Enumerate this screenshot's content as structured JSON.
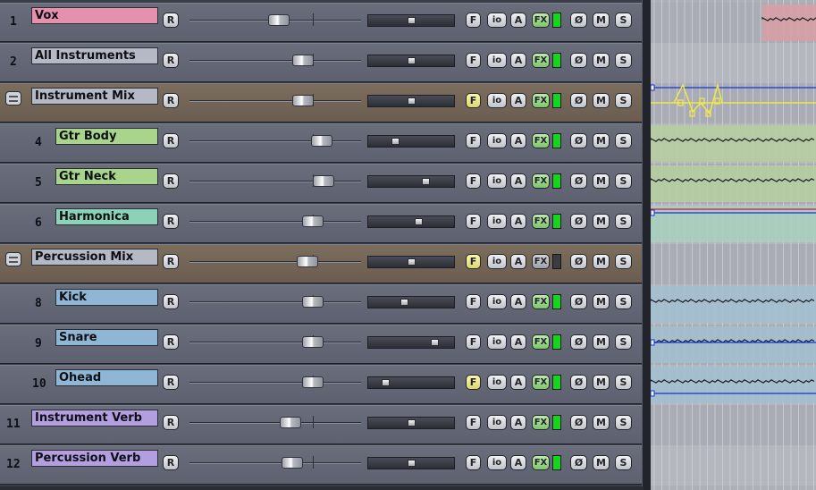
{
  "buttons": {
    "rec_arm": "R",
    "fx_browser": "F",
    "io": "io",
    "automation": "A",
    "fx": "FX",
    "phase": "Ø",
    "mute": "M",
    "solo": "S"
  },
  "colors": {
    "accent_fx_on": "#12d81b",
    "folder_bg": "#7c6d5d",
    "track_bg": "#6a6e7b"
  },
  "tracks": [
    {
      "number": "1",
      "name": "Vox",
      "color": "#e590ad",
      "indent": 0,
      "folder": false,
      "volume": 0.52,
      "pan": 0.5,
      "f_active": false,
      "fx_on": true
    },
    {
      "number": "2",
      "name": "All Instruments",
      "color": "#b5b9c5",
      "indent": 0,
      "folder": false,
      "volume": 0.66,
      "pan": 0.5,
      "f_active": false,
      "fx_on": true
    },
    {
      "number": "",
      "name": "Instrument Mix",
      "color": "#b5b9c5",
      "indent": 0,
      "folder": true,
      "volume": 0.66,
      "pan": 0.5,
      "f_active": true,
      "fx_on": true
    },
    {
      "number": "4",
      "name": "Gtr Body",
      "color": "#a8d48c",
      "indent": 1,
      "folder": false,
      "volume": 0.77,
      "pan": 0.3,
      "f_active": false,
      "fx_on": true
    },
    {
      "number": "5",
      "name": "Gtr Neck",
      "color": "#a8d48c",
      "indent": 1,
      "folder": false,
      "volume": 0.78,
      "pan": 0.68,
      "f_active": false,
      "fx_on": true
    },
    {
      "number": "6",
      "name": "Harmonica",
      "color": "#8bd3b6",
      "indent": 1,
      "folder": false,
      "volume": 0.72,
      "pan": 0.59,
      "f_active": false,
      "fx_on": true
    },
    {
      "number": "",
      "name": "Percussion Mix",
      "color": "#b5b9c5",
      "indent": 0,
      "folder": true,
      "volume": 0.69,
      "pan": 0.5,
      "f_active": true,
      "fx_on": false
    },
    {
      "number": "8",
      "name": "Kick",
      "color": "#8fb6d4",
      "indent": 1,
      "folder": false,
      "volume": 0.72,
      "pan": 0.41,
      "f_active": false,
      "fx_on": true
    },
    {
      "number": "9",
      "name": "Snare",
      "color": "#8fb6d4",
      "indent": 1,
      "folder": false,
      "volume": 0.72,
      "pan": 0.8,
      "f_active": false,
      "fx_on": true
    },
    {
      "number": "10",
      "name": "Ohead",
      "color": "#8fb6d4",
      "indent": 1,
      "folder": false,
      "volume": 0.72,
      "pan": 0.17,
      "f_active": true,
      "fx_on": true
    },
    {
      "number": "11",
      "name": "Instrument Verb",
      "color": "#b39fe0",
      "indent": 0,
      "folder": false,
      "volume": 0.59,
      "pan": 0.5,
      "f_active": false,
      "fx_on": true
    },
    {
      "number": "12",
      "name": "Percussion Verb",
      "color": "#b39fe0",
      "indent": 0,
      "folder": false,
      "volume": 0.6,
      "pan": 0.5,
      "f_active": false,
      "fx_on": true
    }
  ]
}
